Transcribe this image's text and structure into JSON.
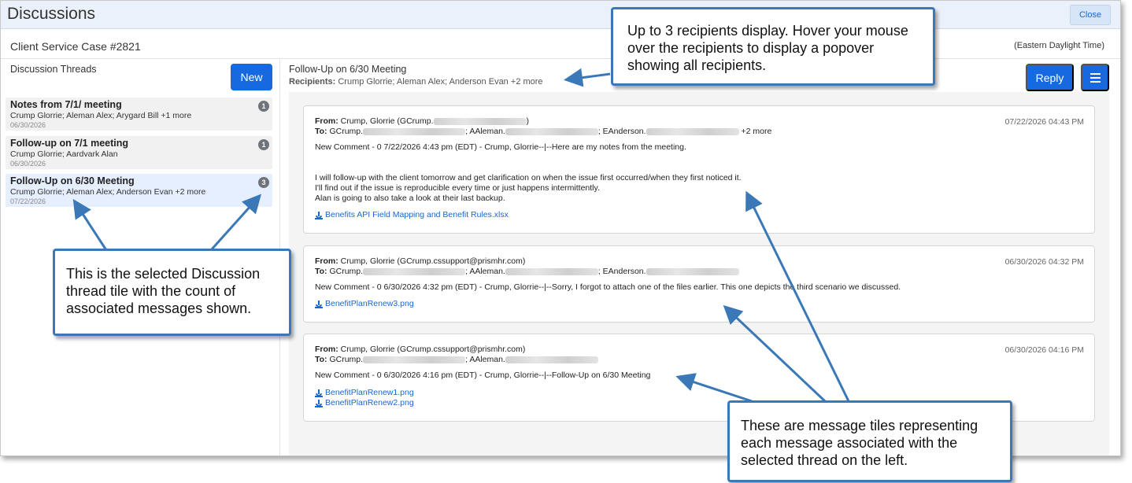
{
  "dialog": {
    "title": "Discussions",
    "close_label": "Close",
    "case_label": "Client Service Case #2821",
    "timezone": "(Eastern Daylight Time)"
  },
  "left": {
    "header": "Discussion Threads",
    "new_label": "New",
    "threads": [
      {
        "title": "Notes from 7/1/ meeting",
        "recipients": "Crump Glorrie; Aleman Alex; Arygard Bill +1 more",
        "date": "06/30/2026",
        "count": "1",
        "selected": false
      },
      {
        "title": "Follow-up on 7/1 meeting",
        "recipients": "Crump Glorrie; Aardvark Alan",
        "date": "06/30/2026",
        "count": "1",
        "selected": false
      },
      {
        "title": "Follow-Up on 6/30 Meeting",
        "recipients": "Crump Glorrie; Aleman Alex; Anderson Evan +2 more",
        "date": "07/22/2026",
        "count": "3",
        "selected": true
      }
    ]
  },
  "right": {
    "thread_title": "Follow-Up on 6/30 Meeting",
    "recipients_label": "Recipients:",
    "recipients": "Crump Glorrie; Aleman Alex; Anderson Evan +2 more",
    "reply_label": "Reply",
    "menu_icon": "hamburger-menu-icon",
    "messages": [
      {
        "from_label": "From:",
        "from": "Crump, Glorrie (GCrump.",
        "from_end": ")",
        "to_label": "To:",
        "to_1": "GCrump.",
        "to_2": "; AAleman.",
        "to_3": "; EAnderson.",
        "to_more": "+2 more",
        "date": "07/22/2026 04:43 PM",
        "body_1": "New Comment - 0 7/22/2026 4:43 pm (EDT) - Crump, Glorrie--|--Here are my notes from the meeting.",
        "body_2": "I will follow-up with the client tomorrow and get clarification on when the issue first occurred/when they first noticed it.",
        "body_3": "I'll find out if the issue is reproducible every time or just happens intermittently.",
        "body_4": "Alan is going to also take a look at their last backup.",
        "attachment_1": "Benefits API Field Mapping and Benefit Rules.xlsx"
      },
      {
        "from_label": "From:",
        "from": "Crump, Glorrie (GCrump.cssupport@prismhr.com)",
        "to_label": "To:",
        "to_1": "GCrump.",
        "to_2": "; AAleman.",
        "to_3": "; EAnderson.",
        "date": "06/30/2026 04:32 PM",
        "body_1": "New Comment - 0 6/30/2026 4:32 pm (EDT) - Crump, Glorrie--|--Sorry, I forgot to attach one of the files earlier. This one depicts the third scenario we discussed.",
        "attachment_1": "BenefitPlanRenew3.png"
      },
      {
        "from_label": "From:",
        "from": "Crump, Glorrie (GCrump.cssupport@prismhr.com)",
        "to_label": "To:",
        "to_1": "GCrump.",
        "to_2": "; AAleman.",
        "date": "06/30/2026 04:16 PM",
        "body_1": "New Comment - 0 6/30/2026 4:16 pm (EDT) - Crump, Glorrie--|--Follow-Up on 6/30 Meeting",
        "attachment_1": "BenefitPlanRenew1.png",
        "attachment_2": "BenefitPlanRenew2.png"
      }
    ]
  },
  "callouts": {
    "recipients_note": "Up to 3 recipients display. Hover your mouse over the recipients to display a popover showing all recipients.",
    "thread_note": "This is the selected Discussion thread tile with the count of associated messages shown.",
    "messages_note": "These are message tiles representing each message associated with the selected thread on the left."
  },
  "colors": {
    "accent": "#1769e0",
    "callout_border": "#3b78b8",
    "selected_tile": "#e6efff"
  }
}
